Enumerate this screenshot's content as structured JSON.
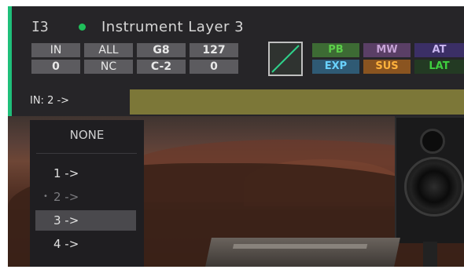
{
  "header": {
    "instrument_id": "I3",
    "instrument_name": "Instrument Layer 3",
    "grid": {
      "row1": [
        "IN",
        "ALL",
        "G8",
        "127"
      ],
      "row2": [
        "0",
        "NC",
        "C-2",
        "0"
      ]
    },
    "tags": {
      "row1": [
        {
          "label": "PB",
          "color": "#5ccf4a",
          "bg": "#3d6b34"
        },
        {
          "label": "MW",
          "color": "#c6a3d6",
          "bg": "#5a3f66"
        },
        {
          "label": "AT",
          "color": "#c9b6f0",
          "bg": "#3b2f66"
        }
      ],
      "row2": [
        {
          "label": "EXP",
          "color": "#69d2ff",
          "bg": "#2f5a74"
        },
        {
          "label": "SUS",
          "color": "#ffb23c",
          "bg": "#8a5420"
        },
        {
          "label": "LAT",
          "color": "#3fcf3f",
          "bg": "#233a23"
        }
      ]
    },
    "input_label": "IN: 2 ->",
    "status_color": "#1fbf5a",
    "accent_color": "#1fbf7a"
  },
  "dropdown": {
    "none_label": "NONE",
    "items": [
      {
        "label": "1 ->",
        "state": "normal"
      },
      {
        "label": "2 ->",
        "state": "current"
      },
      {
        "label": "3 ->",
        "state": "highlighted"
      },
      {
        "label": "4 ->",
        "state": "normal"
      }
    ],
    "current_marker": "•"
  }
}
